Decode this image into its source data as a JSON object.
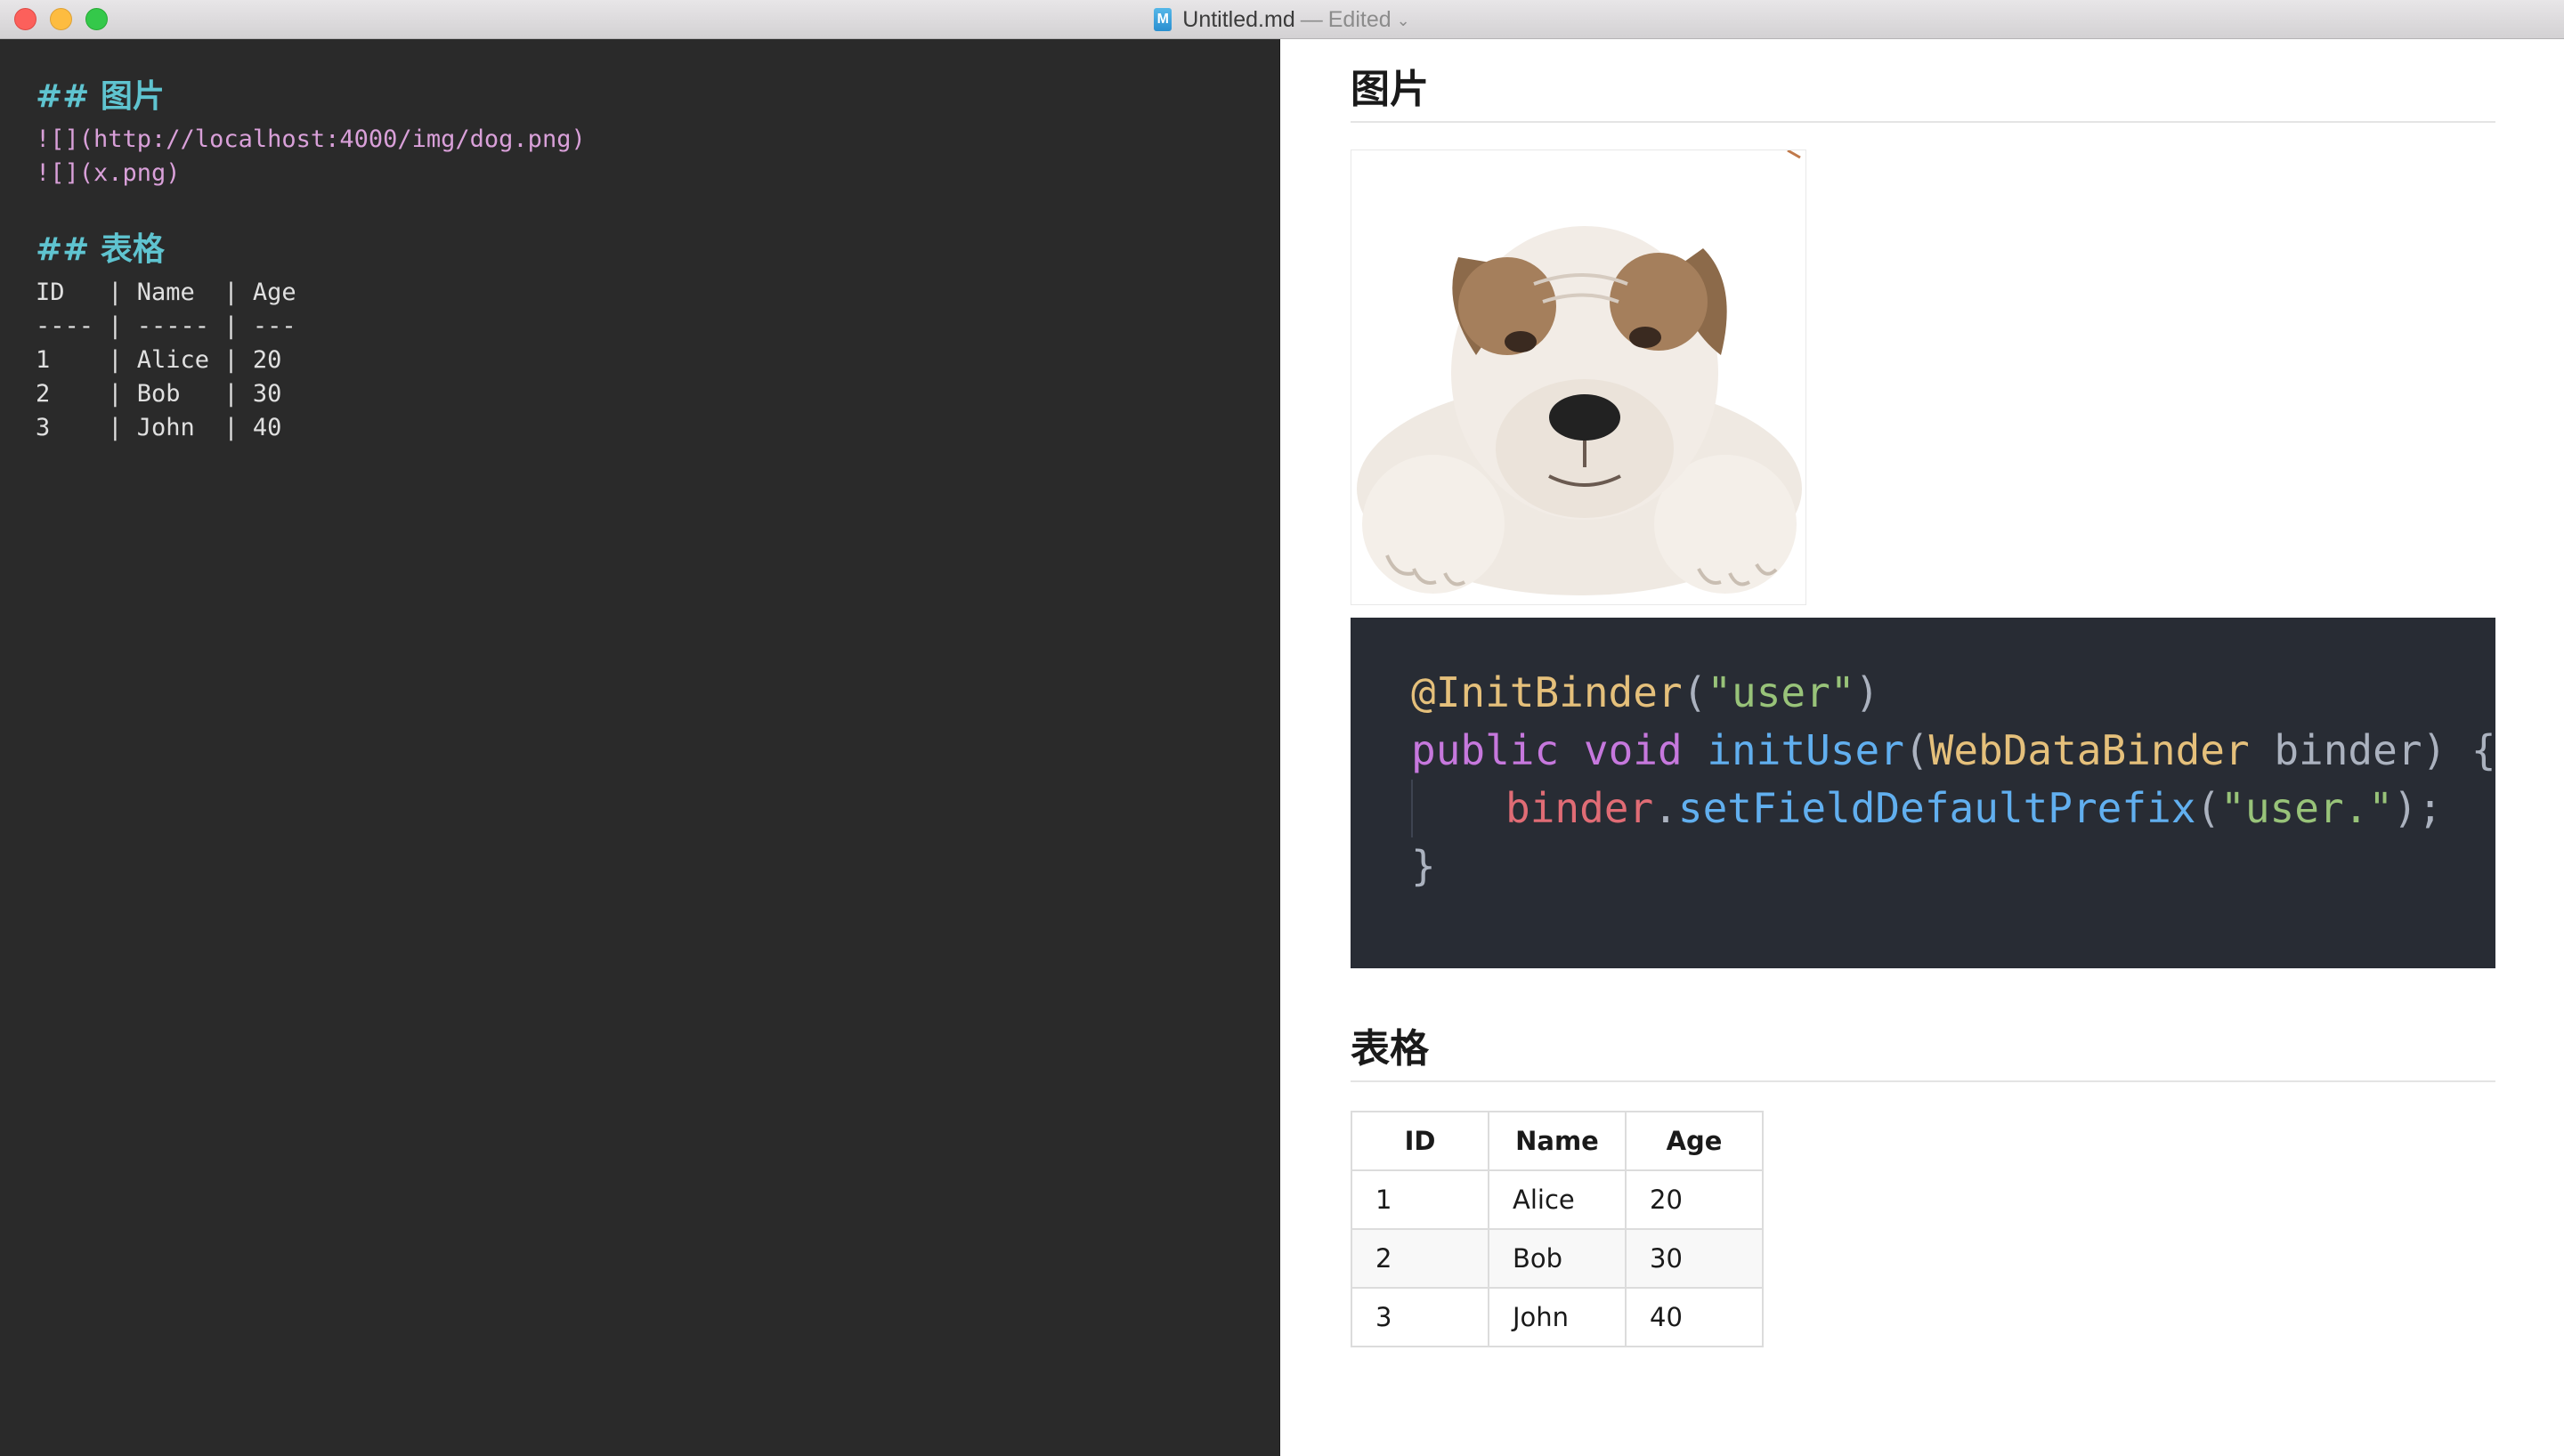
{
  "window": {
    "filename": "Untitled.md",
    "separator": "—",
    "status": "Edited",
    "doc_icon_letter": "M"
  },
  "editor": {
    "lines": [
      {
        "kind": "heading",
        "text": "## 图片"
      },
      {
        "kind": "image",
        "text": "![](http://localhost:4000/img/dog.png)"
      },
      {
        "kind": "image",
        "text": "![](x.png)"
      },
      {
        "kind": "blank",
        "text": ""
      },
      {
        "kind": "heading",
        "text": "## 表格"
      },
      {
        "kind": "plain",
        "text": "ID   | Name  | Age"
      },
      {
        "kind": "plain",
        "text": "---- | ----- | ---"
      },
      {
        "kind": "plain",
        "text": "1    | Alice | 20"
      },
      {
        "kind": "plain",
        "text": "2    | Bob   | 30"
      },
      {
        "kind": "plain",
        "text": "3    | John  | 40"
      }
    ]
  },
  "preview": {
    "heading1": "图片",
    "heading2": "表格",
    "code": {
      "l1_ann": "@InitBinder",
      "l1_p1": "(",
      "l1_str": "\"user\"",
      "l1_p2": ")",
      "l2_kw1": "public",
      "l2_kw2": "void",
      "l2_fn": "initUser",
      "l2_p1": "(",
      "l2_type": "WebDataBinder",
      "l2_arg": " binder",
      "l2_p2": ") {",
      "l3_var": "binder",
      "l3_dot": ".",
      "l3_fn": "setFieldDefaultPrefix",
      "l3_p1": "(",
      "l3_str": "\"user.\"",
      "l3_p2": ");",
      "l4": "}"
    },
    "table": {
      "headers": [
        "ID",
        "Name",
        "Age"
      ],
      "rows": [
        [
          "1",
          "Alice",
          "20"
        ],
        [
          "2",
          "Bob",
          "30"
        ],
        [
          "3",
          "John",
          "40"
        ]
      ]
    }
  }
}
